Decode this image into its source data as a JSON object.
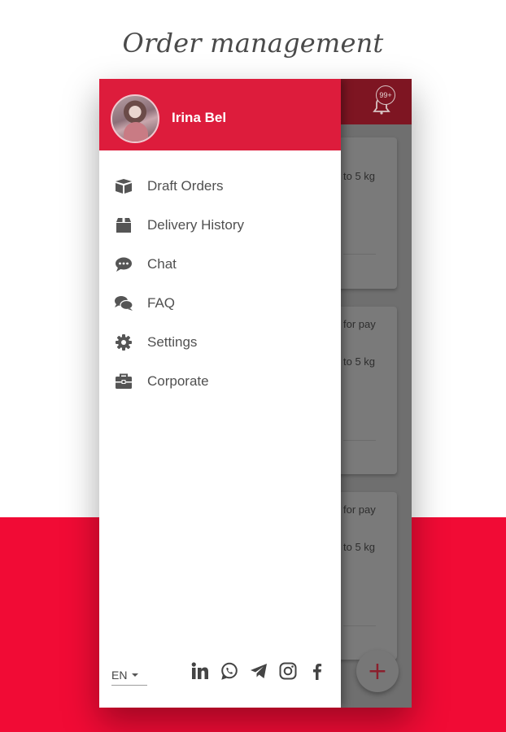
{
  "promo": {
    "title": "Order management"
  },
  "app_bar": {
    "notification_badge": "99+"
  },
  "background_cards": [
    {
      "line1": "",
      "line2": "to 5 kg"
    },
    {
      "line1": "for pay",
      "line2": "to 5 kg"
    },
    {
      "line1": "for pay",
      "line2": "to 5 kg"
    }
  ],
  "fab": {
    "label": "+"
  },
  "drawer": {
    "user_name": "Irina Bel",
    "items": [
      {
        "icon": "boxes-icon",
        "label": "Draft Orders"
      },
      {
        "icon": "box-icon",
        "label": "Delivery History"
      },
      {
        "icon": "chat-bubble-icon",
        "label": "Chat"
      },
      {
        "icon": "comments-icon",
        "label": "FAQ"
      },
      {
        "icon": "gear-icon",
        "label": "Settings"
      },
      {
        "icon": "briefcase-icon",
        "label": "Corporate"
      }
    ],
    "language": "EN",
    "socials": [
      "linkedin-icon",
      "whatsapp-icon",
      "telegram-icon",
      "instagram-icon",
      "facebook-icon"
    ]
  },
  "colors": {
    "brand_red": "#f10b35",
    "drawer_header": "#dd1c3c",
    "overlay_appbar": "#7e1522"
  }
}
